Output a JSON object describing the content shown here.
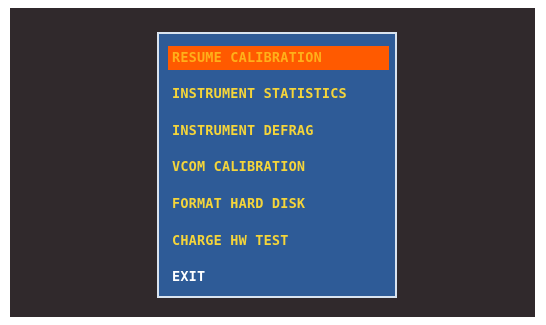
{
  "menu": {
    "items": [
      {
        "label": "RESUME CALIBRATION",
        "selected": true
      },
      {
        "label": "INSTRUMENT STATISTICS"
      },
      {
        "label": "INSTRUMENT DEFRAG"
      },
      {
        "label": "VCOM CALIBRATION"
      },
      {
        "label": "FORMAT HARD DISK"
      },
      {
        "label": "CHARGE HW TEST"
      },
      {
        "label": "EXIT"
      }
    ]
  },
  "colors": {
    "screen_background": "#30292c",
    "panel_background": "#2e5b97",
    "panel_border": "#d9e3ef",
    "item_text": "#f5d53a",
    "selected_background": "#ff5a00",
    "selected_text": "#ffb019",
    "exit_text": "#ffffff"
  }
}
